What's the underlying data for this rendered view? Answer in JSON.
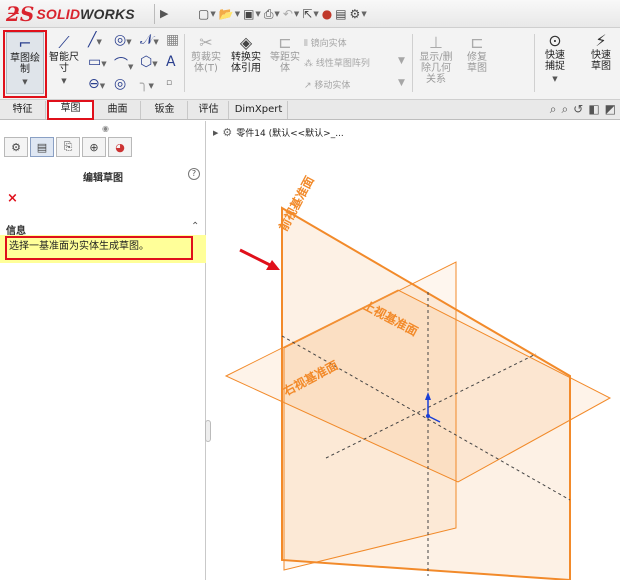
{
  "app": {
    "brand_ds": "ℬ",
    "brand_solid": "SOLID",
    "brand_works": "WORKS"
  },
  "ribbon": {
    "sketch_label": "草图绘制",
    "smart_dim_label": "智能尺寸",
    "trim_label": "剪裁实体(T)",
    "convert_label": "转换实体引用",
    "offset_label": "等距实体",
    "mirror_label": "镜向实体",
    "linear_pattern_label": "线性草图阵列",
    "move_label": "移动实体",
    "show_relations_label": "显示/删除几何关系",
    "repair_label": "修复草图",
    "quick_snap_label": "快速捕捉",
    "rapid_sketch_label": "快速草图"
  },
  "tabs": [
    "特征",
    "草图",
    "曲面",
    "钣金",
    "评估",
    "DimXpert"
  ],
  "active_tab": "草图",
  "tree": {
    "part_name": "零件14 (默认<<默认>_..."
  },
  "panel": {
    "title": "编辑草图",
    "help": "?",
    "cancel": "×",
    "info_header": "信息",
    "info_message": "选择一基准面为实体生成草图。"
  },
  "planes": {
    "front": "前视基准面",
    "top": "上视基准面",
    "right": "右视基准面"
  },
  "colors": {
    "accent_red": "#e0101b",
    "plane_orange": "#f28a2a",
    "info_yellow": "#ffff99",
    "origin_blue": "#1a3fd6"
  }
}
